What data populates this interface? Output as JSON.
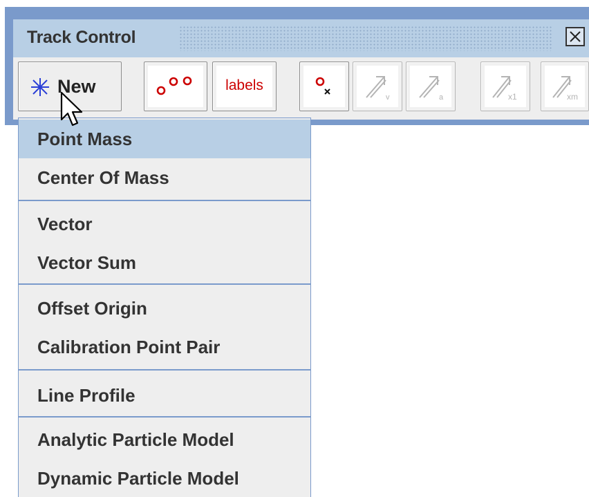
{
  "window": {
    "title": "Track Control"
  },
  "toolbar": {
    "new_label": "New",
    "labels_button": "labels",
    "buttons": [
      {
        "name": "new-button",
        "icon": "asterisk-icon",
        "enabled": true
      },
      {
        "name": "positions-button",
        "icon": "footprint-circles-icon",
        "enabled": true
      },
      {
        "name": "labels-button",
        "icon": "labels-icon",
        "enabled": true
      },
      {
        "name": "xmass-button",
        "icon": "marker-x-icon",
        "enabled": true
      },
      {
        "name": "velocity-button",
        "icon": "velocity-vector-icon",
        "enabled": false
      },
      {
        "name": "acceleration-button",
        "icon": "acceleration-vector-icon",
        "enabled": false
      },
      {
        "name": "force-x1-button",
        "icon": "vector-x1-icon",
        "enabled": false
      },
      {
        "name": "force-xm-button",
        "icon": "vector-xm-icon",
        "enabled": false
      }
    ],
    "icon_subscripts": {
      "velocity": "v",
      "acceleration": "a",
      "x1": "x1",
      "xm": "xm"
    }
  },
  "menu": {
    "items": [
      {
        "label": "Point Mass",
        "selected": true
      },
      {
        "label": "Center Of Mass",
        "selected": false
      },
      {
        "label": "Vector",
        "selected": false
      },
      {
        "label": "Vector Sum",
        "selected": false
      },
      {
        "label": "Offset Origin",
        "selected": false
      },
      {
        "label": "Calibration Point Pair",
        "selected": false
      },
      {
        "label": "Line Profile",
        "selected": false
      },
      {
        "label": "Analytic Particle Model",
        "selected": false
      },
      {
        "label": "Dynamic Particle Model",
        "selected": false
      }
    ]
  },
  "colors": {
    "window_border": "#7a9acb",
    "titlebar": "#b8cfe5",
    "menu_background": "#eeeeee",
    "menu_selection": "#b8cfe5",
    "icon_red": "#cc0000",
    "new_icon_blue": "#2a3fd6"
  }
}
